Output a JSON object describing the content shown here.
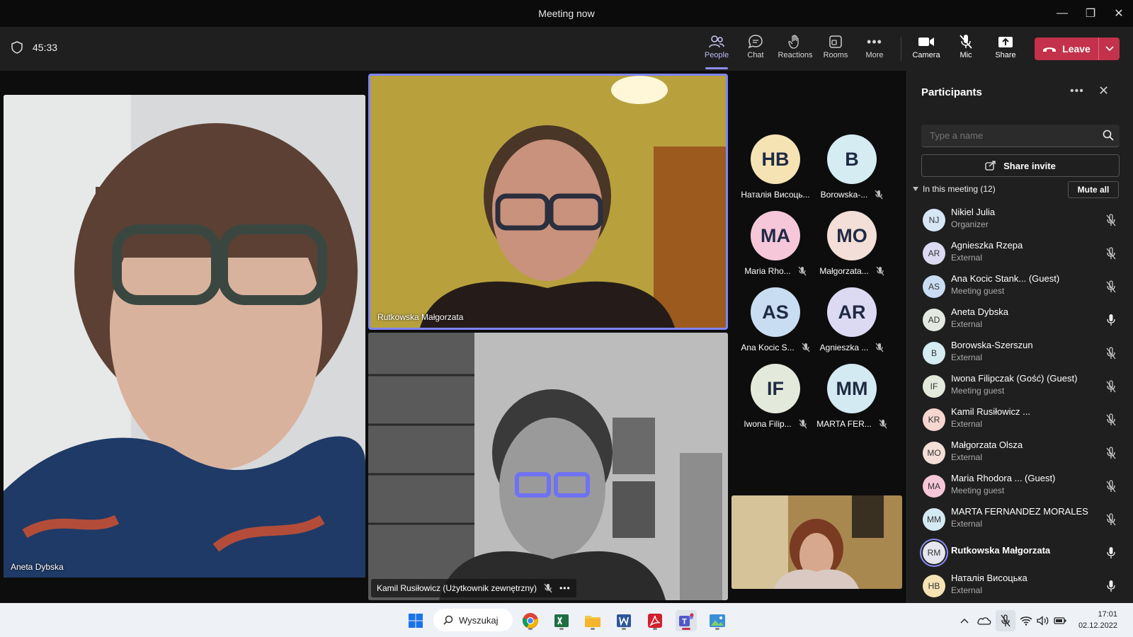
{
  "window": {
    "title": "Meeting now"
  },
  "toolbar": {
    "timer": "45:33",
    "buttons": [
      {
        "label": "People",
        "icon": "people-icon"
      },
      {
        "label": "Chat",
        "icon": "chat-icon"
      },
      {
        "label": "Reactions",
        "icon": "reactions-icon"
      },
      {
        "label": "Rooms",
        "icon": "rooms-icon"
      },
      {
        "label": "More",
        "icon": "more-icon"
      },
      {
        "label": "Camera",
        "icon": "camera-icon"
      },
      {
        "label": "Mic",
        "icon": "mic-off-icon"
      },
      {
        "label": "Share",
        "icon": "share-icon"
      }
    ],
    "leave_label": "Leave"
  },
  "stage": {
    "tiles": [
      {
        "name": "Aneta Dybska"
      },
      {
        "name": "Rutkowska Małgorzata"
      },
      {
        "name": "Kamil Rusiłowicz (Użytkownik zewnętrzny)"
      }
    ],
    "avatars": [
      {
        "initials": "HB",
        "label": "Наталія Висоць...",
        "color": "#f6e3b4"
      },
      {
        "initials": "B",
        "label": "Borowska-...",
        "color": "#d4ecf2"
      },
      {
        "initials": "MA",
        "label": "Maria Rho...",
        "color": "#f6c7d8"
      },
      {
        "initials": "MO",
        "label": "Małgorzata...",
        "color": "#f3dfd7"
      },
      {
        "initials": "AS",
        "label": "Ana Kocic S...",
        "color": "#c9ddf2"
      },
      {
        "initials": "AR",
        "label": "Agnieszka ...",
        "color": "#dcdaf3"
      },
      {
        "initials": "IF",
        "label": "Iwona Filip...",
        "color": "#e4eadb"
      },
      {
        "initials": "MM",
        "label": "MARTA FER...",
        "color": "#d3eaf2"
      }
    ]
  },
  "panel": {
    "title": "Participants",
    "search_placeholder": "Type a name",
    "share_invite": "Share invite",
    "section": "In this meeting (12)",
    "mute_all": "Mute all",
    "participants": [
      {
        "initials": "NJ",
        "name": "Nikiel Julia",
        "role": "Organizer",
        "color": "#d7e6f5",
        "mic": "off"
      },
      {
        "initials": "AR",
        "name": "Agnieszka Rzepa",
        "role": "External",
        "color": "#dcdaf3",
        "mic": "off"
      },
      {
        "initials": "AS",
        "name": "Ana Kocic Stank...  (Guest)",
        "role": "Meeting guest",
        "color": "#c9ddf2",
        "mic": "off"
      },
      {
        "initials": "AD",
        "name": "Aneta Dybska",
        "role": "External",
        "color": "#e3e8e0",
        "mic": "on"
      },
      {
        "initials": "B",
        "name": "Borowska-Szerszun",
        "role": "External",
        "color": "#d4ecf2",
        "mic": "off"
      },
      {
        "initials": "IF",
        "name": "Iwona Filipczak (Gość) (Guest)",
        "role": "Meeting guest",
        "color": "#e4eadb",
        "mic": "off"
      },
      {
        "initials": "KR",
        "name": "Kamil Rusiłowicz ...",
        "role": "External",
        "color": "#f6d7cf",
        "mic": "off"
      },
      {
        "initials": "MO",
        "name": "Małgorzata Olsza",
        "role": "External",
        "color": "#f3dfd7",
        "mic": "off"
      },
      {
        "initials": "MA",
        "name": "Maria Rhodora ...  (Guest)",
        "role": "Meeting guest",
        "color": "#f6c7d8",
        "mic": "off"
      },
      {
        "initials": "MM",
        "name": "MARTA FERNANDEZ MORALES",
        "role": "External",
        "color": "#d3eaf2",
        "mic": "off"
      },
      {
        "initials": "RM",
        "name": "Rutkowska Małgorzata",
        "role": "",
        "color": "#e6e6ee",
        "mic": "on"
      },
      {
        "initials": "HB",
        "name": "Наталія Висоцька",
        "role": "External",
        "color": "#f6e3b4",
        "mic": "on"
      }
    ]
  },
  "taskbar": {
    "search_label": "Wyszukaj",
    "time": "17:01",
    "date": "02.12.2022"
  }
}
